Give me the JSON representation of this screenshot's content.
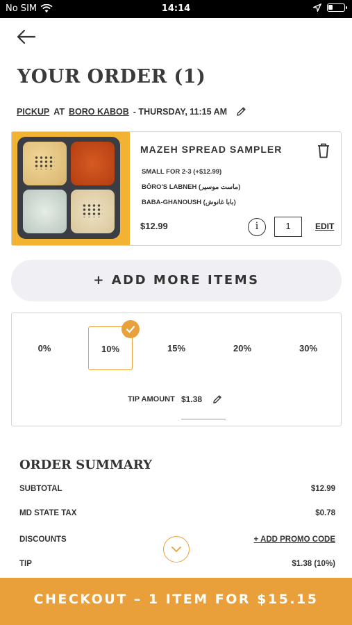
{
  "status_bar": {
    "carrier": "No SIM",
    "time": "14:14"
  },
  "page": {
    "title": "YOUR ORDER (1)"
  },
  "pickup": {
    "mode": "PICKUP",
    "at": "AT",
    "location": "BORO KABOB",
    "time": "- THURSDAY, 11:15 AM"
  },
  "item": {
    "name": "MAZEH SPREAD SAMPLER",
    "modifiers": [
      "SMALL FOR 2-3 (+$12.99)",
      "BŌRO'S LABNEH (ماست موسير)",
      "BABA-GHANOUSH (بابا غانوش)"
    ],
    "price": "$12.99",
    "info_label": "i",
    "quantity": "1",
    "edit_label": "EDIT"
  },
  "add_more_label": "+ ADD MORE ITEMS",
  "tip": {
    "options": [
      "0%",
      "10%",
      "15%",
      "20%",
      "30%"
    ],
    "selected": "10%",
    "amount_label": "TIP AMOUNT",
    "amount": "$1.38"
  },
  "summary": {
    "title": "ORDER SUMMARY",
    "subtotal_label": "SUBTOTAL",
    "subtotal": "$12.99",
    "tax_label": "MD STATE TAX",
    "tax": "$0.78",
    "discounts_label": "DISCOUNTS",
    "promo_label": "+ ADD PROMO CODE",
    "tip_label": "TIP",
    "tip": "$1.38 (10%)"
  },
  "checkout_label": "CHECKOUT – 1 ITEM FOR $15.15",
  "colors": {
    "accent": "#e99f3a",
    "text": "#333333",
    "pill_bg": "#f0f0f4"
  }
}
